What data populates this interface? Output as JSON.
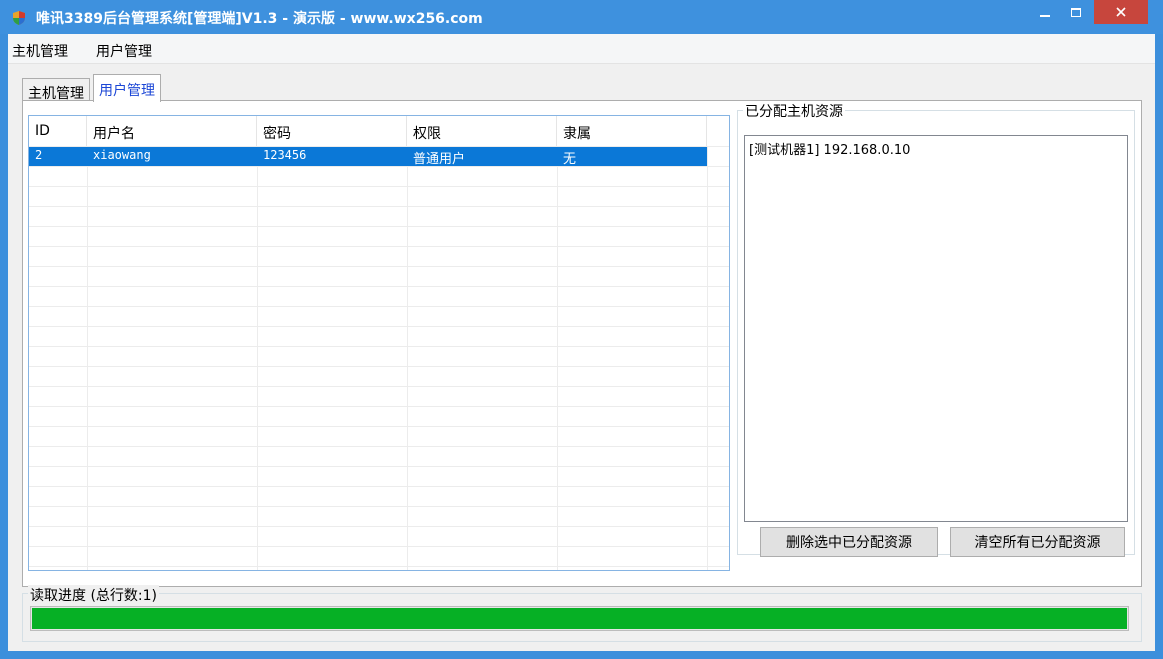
{
  "window": {
    "title": "唯讯3389后台管理系统[管理端]V1.3 - 演示版 - www.wx256.com",
    "icon": "shield-icon",
    "controls": [
      "minimize-icon",
      "maximize-icon",
      "close-icon"
    ]
  },
  "menubar": {
    "items": [
      {
        "label": "主机管理"
      },
      {
        "label": "用户管理"
      }
    ]
  },
  "tabs": [
    {
      "label": "主机管理",
      "active": false
    },
    {
      "label": "用户管理",
      "active": true
    }
  ],
  "users_table": {
    "columns": [
      "ID",
      "用户名",
      "密码",
      "权限",
      "隶属"
    ],
    "rows": [
      {
        "id": "2",
        "username": "xiaowang",
        "password": "123456",
        "role": "普通用户",
        "belongs": "无",
        "selected": true
      }
    ]
  },
  "assigned_resources": {
    "group_label": "已分配主机资源",
    "items": [
      "[测试机器1] 192.168.0.10"
    ],
    "delete_selected_label": "删除选中已分配资源",
    "clear_all_label": "清空所有已分配资源"
  },
  "progress": {
    "label": "读取进度 (总行数:1)",
    "value_percent": 100,
    "color": "#06b025"
  },
  "colors": {
    "titlebar": "#3e91de",
    "selection": "#0b78d7",
    "close_button": "#c7463d"
  }
}
